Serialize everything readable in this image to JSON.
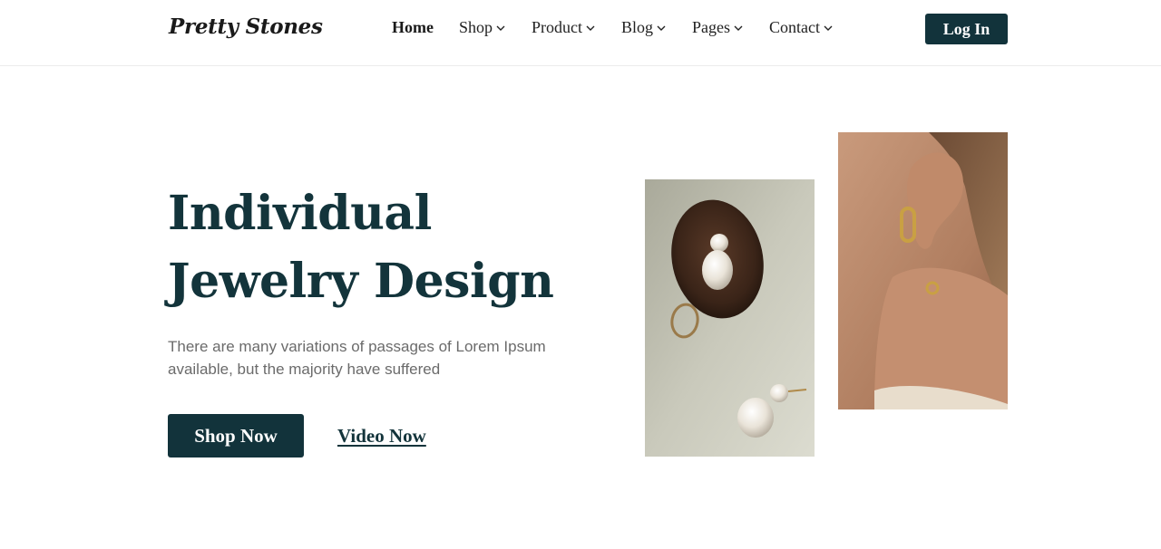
{
  "brand": {
    "name": "Pretty Stones"
  },
  "nav": {
    "items": [
      {
        "label": "Home",
        "active": true,
        "dropdown": false
      },
      {
        "label": "Shop",
        "active": false,
        "dropdown": true
      },
      {
        "label": "Product",
        "active": false,
        "dropdown": true
      },
      {
        "label": "Blog",
        "active": false,
        "dropdown": true
      },
      {
        "label": "Pages",
        "active": false,
        "dropdown": true
      },
      {
        "label": "Contact",
        "active": false,
        "dropdown": true
      }
    ],
    "login_label": "Log In"
  },
  "hero": {
    "title_line1": "Individual",
    "title_line2": "Jewelry Design",
    "description": "There are many variations of passages of Lorem Ipsum available, but the majority have suffered",
    "primary_cta": "Shop Now",
    "secondary_cta": "Video Now"
  },
  "images": [
    {
      "name": "pearl-earrings-photo"
    },
    {
      "name": "gold-earring-model-photo"
    }
  ],
  "colors": {
    "primary": "#12333b",
    "text_muted": "#6b6b6b",
    "background": "#ffffff"
  }
}
